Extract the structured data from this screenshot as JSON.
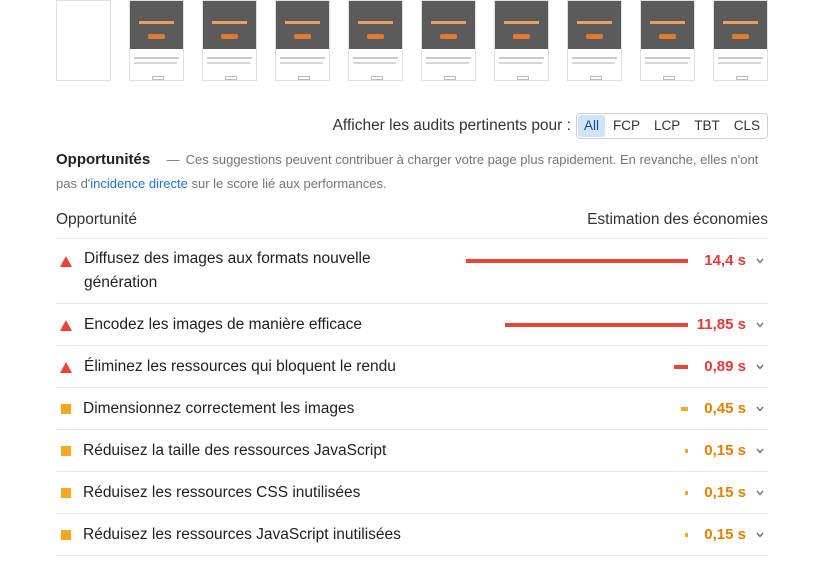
{
  "filmstrip_count": 10,
  "filter": {
    "label": "Afficher les audits pertinents pour :",
    "chips": [
      {
        "label": "All",
        "active": true
      },
      {
        "label": "FCP",
        "active": false
      },
      {
        "label": "LCP",
        "active": false
      },
      {
        "label": "TBT",
        "active": false
      },
      {
        "label": "CLS",
        "active": false
      }
    ]
  },
  "opportunities": {
    "title": "Opportunités",
    "dash": "—",
    "desc_before": "Ces suggestions peuvent contribuer à charger votre page plus rapidement. En revanche, elles n'ont pas d'",
    "desc_link": "incidence directe",
    "desc_after": " sur le score lié aux performances.",
    "col_left": "Opportunité",
    "col_right": "Estimation des économies",
    "items": [
      {
        "title": "Diffusez des images aux formats nouvelle génération",
        "value": "14,4 s",
        "seconds": 14.4,
        "severity": "fail"
      },
      {
        "title": "Encodez les images de manière efficace",
        "value": "11,85 s",
        "seconds": 11.85,
        "severity": "fail"
      },
      {
        "title": "Éliminez les ressources qui bloquent le rendu",
        "value": "0,89 s",
        "seconds": 0.89,
        "severity": "fail"
      },
      {
        "title": "Dimensionnez correctement les images",
        "value": "0,45 s",
        "seconds": 0.45,
        "severity": "average"
      },
      {
        "title": "Réduisez la taille des ressources JavaScript",
        "value": "0,15 s",
        "seconds": 0.15,
        "severity": "average"
      },
      {
        "title": "Réduisez les ressources CSS inutilisées",
        "value": "0,15 s",
        "seconds": 0.15,
        "severity": "average"
      },
      {
        "title": "Réduisez les ressources JavaScript inutilisées",
        "value": "0,15 s",
        "seconds": 0.15,
        "severity": "average"
      }
    ]
  },
  "colors": {
    "fail": "#eb4335",
    "average": "#f5a623",
    "link": "#1a73e8"
  }
}
